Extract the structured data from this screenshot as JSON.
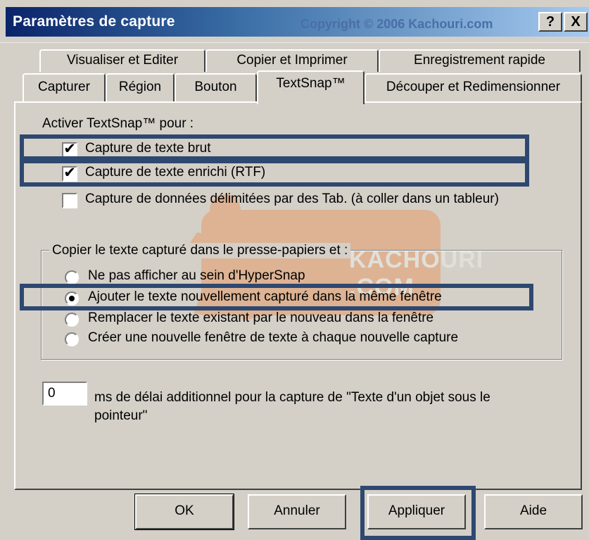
{
  "window": {
    "title": "Paramètres de capture",
    "copyright": "Copyright © 2006 Kachouri.com",
    "help_label": "?",
    "close_label": "X"
  },
  "tabs": {
    "row1": [
      "Visualiser et Editer",
      "Copier et Imprimer",
      "Enregistrement rapide"
    ],
    "row2": [
      "Capturer",
      "Région",
      "Bouton",
      "TextSnap™",
      "Découper et Redimensionner"
    ],
    "active": "TextSnap™"
  },
  "textsnap": {
    "activate_label": "Activer TextSnap™ pour :",
    "checkboxes": [
      {
        "label": "Capture de texte brut",
        "checked": true
      },
      {
        "label": "Capture de texte enrichi (RTF)",
        "checked": true
      },
      {
        "label": "Capture de données délimitées par des Tab. (à coller dans un tableur)",
        "checked": false
      }
    ],
    "clipboard_group": {
      "legend": "Copier le texte capturé dans le presse-papiers et :",
      "radios": [
        {
          "label": "Ne pas afficher au sein d'HyperSnap",
          "selected": false
        },
        {
          "label": "Ajouter le texte nouvellement capturé dans la même fenêtre",
          "selected": true
        },
        {
          "label": "Remplacer le texte existant par le nouveau dans la fenêtre",
          "selected": false
        },
        {
          "label": "Créer une nouvelle fenêtre de texte à chaque nouvelle capture",
          "selected": false
        }
      ]
    },
    "delay": {
      "value": "0",
      "label_line1": "ms de délai additionnel pour la capture de \"Texte d'un objet sous le",
      "label_line2": "pointeur\""
    }
  },
  "buttons": {
    "ok": "OK",
    "cancel": "Annuler",
    "apply": "Appliquer",
    "help": "Aide"
  },
  "watermark": {
    "text": "KACHOURI .COM"
  },
  "colors": {
    "titlebar_start": "#0a246a",
    "titlebar_end": "#a6caf0",
    "highlight": "#2e4870",
    "dialog_bg": "#d4d0c8",
    "watermark": "#f07828"
  }
}
